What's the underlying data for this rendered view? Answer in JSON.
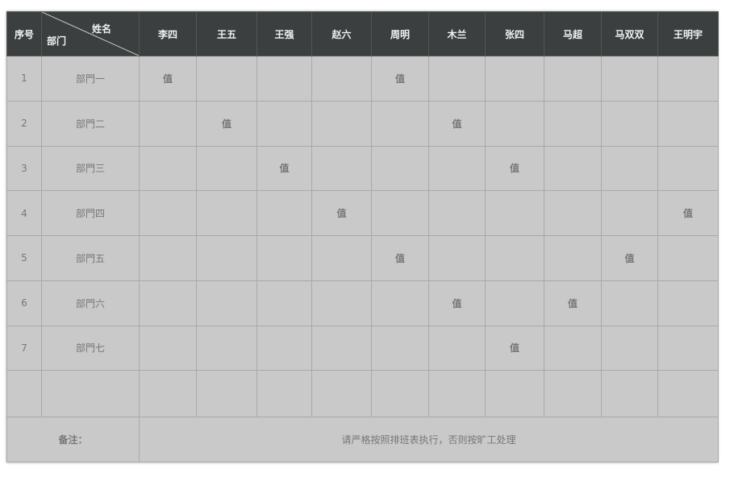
{
  "header": {
    "index_label": "序号",
    "diag_top_label": "姓名",
    "diag_bottom_label": "部门",
    "names": [
      "李四",
      "王五",
      "王强",
      "赵六",
      "周明",
      "木兰",
      "张四",
      "马超",
      "马双双",
      "王明宇"
    ]
  },
  "rows": [
    {
      "index": "1",
      "dept": "部門一",
      "marks": [
        "值",
        "",
        "",
        "",
        "值",
        "",
        "",
        "",
        "",
        ""
      ]
    },
    {
      "index": "2",
      "dept": "部門二",
      "marks": [
        "",
        "值",
        "",
        "",
        "",
        "值",
        "",
        "",
        "",
        ""
      ]
    },
    {
      "index": "3",
      "dept": "部門三",
      "marks": [
        "",
        "",
        "值",
        "",
        "",
        "",
        "值",
        "",
        "",
        ""
      ]
    },
    {
      "index": "4",
      "dept": "部門四",
      "marks": [
        "",
        "",
        "",
        "值",
        "",
        "",
        "",
        "",
        "",
        "值"
      ]
    },
    {
      "index": "5",
      "dept": "部門五",
      "marks": [
        "",
        "",
        "",
        "",
        "值",
        "",
        "",
        "",
        "值",
        ""
      ]
    },
    {
      "index": "6",
      "dept": "部門六",
      "marks": [
        "",
        "",
        "",
        "",
        "",
        "值",
        "",
        "值",
        "",
        ""
      ]
    },
    {
      "index": "7",
      "dept": "部門七",
      "marks": [
        "",
        "",
        "",
        "",
        "",
        "",
        "值",
        "",
        "",
        ""
      ]
    }
  ],
  "note": {
    "label": "备注：",
    "text": "请严格按照排班表执行，否则按旷工处理"
  }
}
